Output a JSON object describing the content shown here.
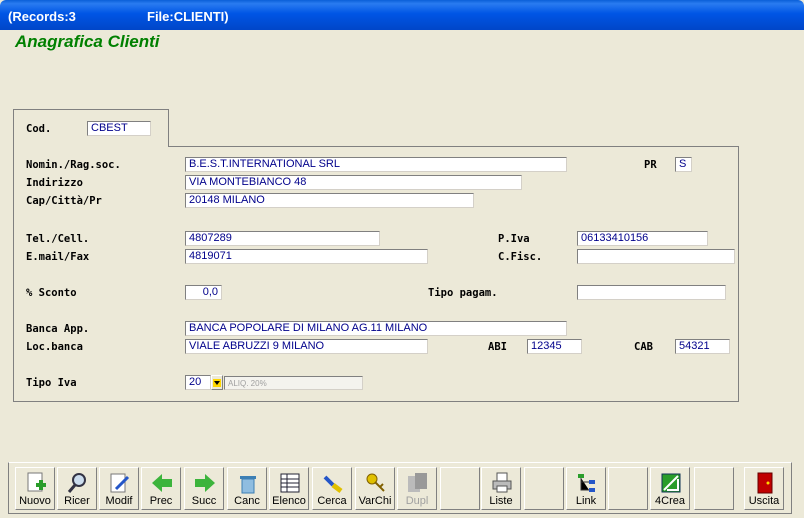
{
  "window": {
    "records": "(Records:3",
    "file": "File:CLIENTI)"
  },
  "form_title": "Anagrafica Clienti",
  "tab": {
    "cod_label": "Cod.",
    "cod_value": "CBEST"
  },
  "fields": {
    "nomin_label": "Nomin./Rag.soc.",
    "nomin_value": "B.E.S.T.INTERNATIONAL SRL",
    "pr_label": "PR",
    "pr_value": "S",
    "indirizzo_label": "Indirizzo",
    "indirizzo_value": "VIA MONTEBIANCO 48",
    "cap_label": "Cap/Città/Pr",
    "cap_value": "20148 MILANO",
    "tel_label": "Tel./Cell.",
    "tel_value": "4807289",
    "piva_label": "P.Iva",
    "piva_value": "06133410156",
    "email_label": "E.mail/Fax",
    "email_value": "4819071",
    "cfisc_label": "C.Fisc.",
    "cfisc_value": "",
    "sconto_label": "% Sconto",
    "sconto_value": "0,0",
    "tipopag_label": "Tipo pagam.",
    "tipopag_value": "",
    "banca_label": "Banca App.",
    "banca_value": "BANCA POPOLARE DI MILANO AG.11 MILANO",
    "locbanca_label": "Loc.banca",
    "locbanca_value": "VIALE ABRUZZI 9 MILANO",
    "abi_label": "ABI",
    "abi_value": "12345",
    "cab_label": "CAB",
    "cab_value": "54321",
    "tipoiva_label": "Tipo Iva",
    "tipoiva_value": "20",
    "tipoiva_desc": "ALIQ. 20%"
  },
  "toolbar": {
    "nuovo": "Nuovo",
    "ricer": "Ricer",
    "modif": "Modif",
    "prec": "Prec",
    "succ": "Succ",
    "canc": "Canc",
    "elenco": "Elenco",
    "cerca": "Cerca",
    "varchi": "VarChi",
    "dupl": "Dupl",
    "liste": "Liste",
    "link": "Link",
    "crea": "4Crea",
    "uscita": "Uscita"
  },
  "colors": {
    "title_green": "#008000",
    "field_text": "#00008b",
    "titlebar_blue": "#0055e5"
  }
}
